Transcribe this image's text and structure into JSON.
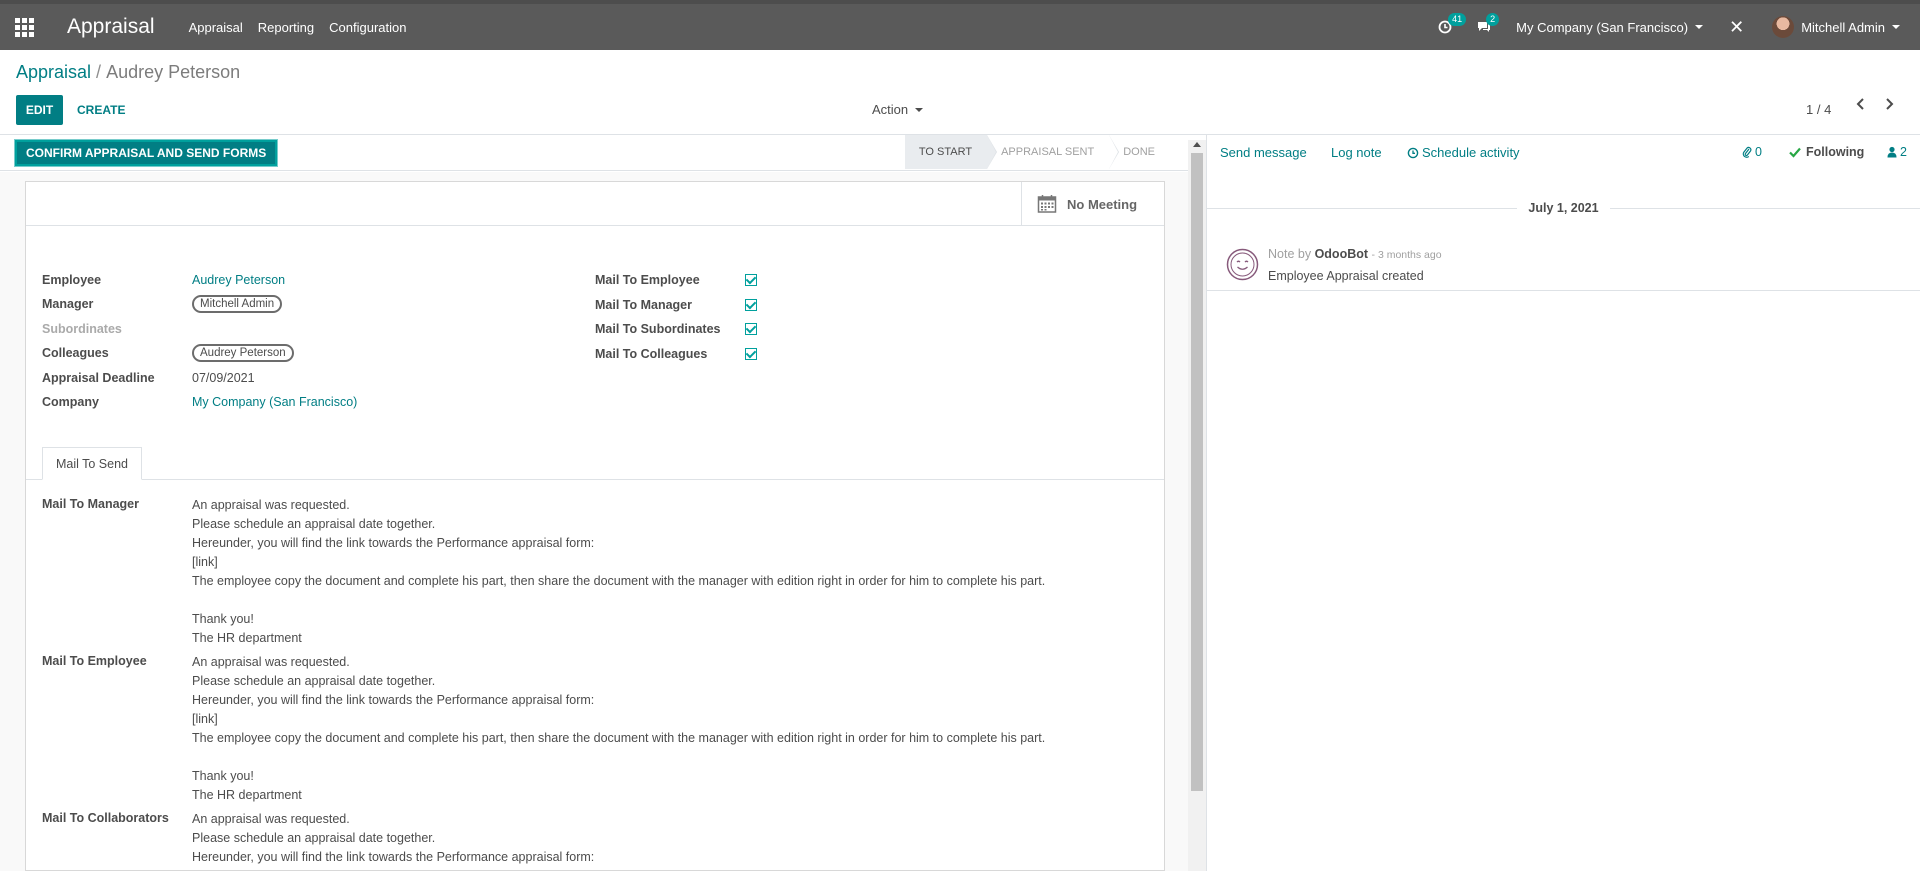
{
  "navbar": {
    "app_name": "Appraisal",
    "menu": [
      "Appraisal",
      "Reporting",
      "Configuration"
    ],
    "activity_count": "41",
    "message_count": "2",
    "company": "My Company (San Francisco)",
    "user": "Mitchell Admin"
  },
  "breadcrumb": {
    "parent": "Appraisal",
    "separator": "/",
    "current": "Audrey Peterson"
  },
  "toolbar": {
    "edit_label": "EDIT",
    "create_label": "CREATE",
    "action_label": "Action"
  },
  "pager": {
    "value": "1 / 4"
  },
  "statusbar": {
    "confirm_label": "CONFIRM APPRAISAL AND SEND FORMS",
    "stages": [
      "TO START",
      "APPRAISAL SENT",
      "DONE"
    ],
    "active_stage": "TO START"
  },
  "form": {
    "meeting_label": "No Meeting",
    "left_fields": {
      "employee_label": "Employee",
      "employee_value": "Audrey Peterson",
      "manager_label": "Manager",
      "manager_value": "Mitchell Admin",
      "subordinates_label": "Subordinates",
      "colleagues_label": "Colleagues",
      "colleagues_value": "Audrey Peterson",
      "deadline_label": "Appraisal Deadline",
      "deadline_value": "07/09/2021",
      "company_label": "Company",
      "company_value": "My Company (San Francisco)"
    },
    "right_fields": {
      "mail_employee_label": "Mail To Employee",
      "mail_manager_label": "Mail To Manager",
      "mail_subordinates_label": "Mail To Subordinates",
      "mail_colleagues_label": "Mail To Colleagues"
    },
    "tab_label": "Mail To Send",
    "mails": {
      "manager_label": "Mail To Manager",
      "manager_body": "An appraisal was requested.\nPlease schedule an appraisal date together.\nHereunder, you will find the link towards the Performance appraisal form:\n[link]\nThe employee copy the document and complete his part, then share the document with the manager with edition right in order for him to complete his part.\n\nThank you!\nThe HR department",
      "employee_label": "Mail To Employee",
      "employee_body": "An appraisal was requested.\nPlease schedule an appraisal date together.\nHereunder, you will find the link towards the Performance appraisal form:\n[link]\nThe employee copy the document and complete his part, then share the document with the manager with edition right in order for him to complete his part.\n\nThank you!\nThe HR department",
      "collaborators_label": "Mail To Collaborators",
      "collaborators_body": "An appraisal was requested.\nPlease schedule an appraisal date together.\nHereunder, you will find the link towards the Performance appraisal form:"
    }
  },
  "chatter": {
    "send_message": "Send message",
    "log_note": "Log note",
    "schedule_activity": "Schedule activity",
    "attachments_count": "0",
    "following_label": "Following",
    "followers_count": "2",
    "date_separator": "July 1, 2021",
    "message": {
      "prefix": "Note by",
      "author": "OdooBot",
      "when": "- 3 months ago",
      "body": "Employee Appraisal created"
    }
  },
  "colors": {
    "primary": "#017e84",
    "navbar": "#5a5a5a",
    "accent": "#00a09d"
  }
}
